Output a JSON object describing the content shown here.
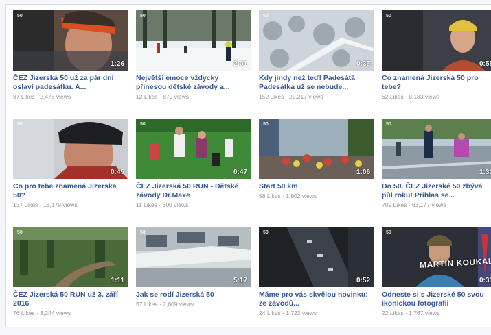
{
  "badge": "50",
  "videos": [
    {
      "title": "ČEZ Jizerská 50 už za pár dní oslaví padesátku. A...",
      "likes": "87 Likes",
      "views": "2,478 views",
      "duration": "1:26",
      "overlay": ""
    },
    {
      "title": "Největší emoce vždycky přinesou dětské závody a...",
      "likes": "12 Likes",
      "views": "870 views",
      "duration": "2:01",
      "overlay": ""
    },
    {
      "title": "Kdy jindy než teď! Padesátá Padesátka už se nebude...",
      "likes": "152 Likes",
      "views": "22,217 views",
      "duration": "0:35",
      "overlay": ""
    },
    {
      "title": "Co znamená Jizerská 50 pro tebe?",
      "likes": "62 Likes",
      "views": "8,183 views",
      "duration": "0:55",
      "overlay": ""
    },
    {
      "title": "Co pro tebe znamená Jizerská 50?",
      "likes": "137 Likes",
      "views": "18,179 views",
      "duration": "0:45",
      "overlay": ""
    },
    {
      "title": "ČEZ Jizerská 50 RUN - Dětské závody Dr.Maxe",
      "likes": "11 Likes",
      "views": "300 views",
      "duration": "0:47",
      "overlay": ""
    },
    {
      "title": "Start 50 km",
      "likes": "58 Likes",
      "views": "1,902 views",
      "duration": "1:06",
      "overlay": ""
    },
    {
      "title": "Do 50. ČEZ Jizerské 50 zbývá půl roku! Přihlas se...",
      "likes": "709 Likes",
      "views": "63,177 views",
      "duration": "1:31",
      "overlay": ""
    },
    {
      "title": "ČEZ Jizerská 50 RUN už 3. září 2016",
      "likes": "76 Likes",
      "views": "3,244 views",
      "duration": "1:11",
      "overlay": ""
    },
    {
      "title": "Jak se rodí Jizerská 50",
      "likes": "57 Likes",
      "views": "2,609 views",
      "duration": "5:17",
      "overlay": ""
    },
    {
      "title": "Máme pro vás skvělou novinku: ze závodů...",
      "likes": "24 Likes",
      "views": "1,723 views",
      "duration": "0:52",
      "overlay": ""
    },
    {
      "title": "Odneste si s Jizerské 50 svou ikonickou fotografii",
      "likes": "22 Likes",
      "views": "1,767 views",
      "duration": "0:31",
      "overlay": "MARTIN KOUKAL"
    }
  ]
}
